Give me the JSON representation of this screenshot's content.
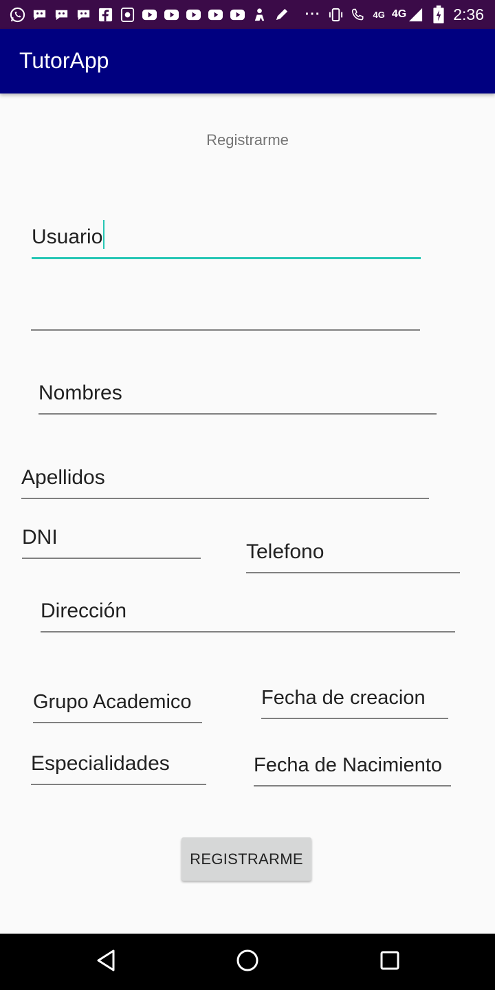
{
  "status_bar": {
    "icons": [
      "whatsapp-icon",
      "messenger-icon",
      "messenger-icon",
      "messenger-icon",
      "facebook-icon",
      "phone-app-icon",
      "youtube-icon",
      "youtube-icon",
      "youtube-icon",
      "youtube-icon",
      "youtube-icon",
      "person-icon",
      "pen-icon"
    ],
    "overflow": "···",
    "network": "4G",
    "network2": "4G",
    "time": "2:36"
  },
  "app_bar": {
    "title": "TutorApp"
  },
  "form": {
    "heading": "Registrarme",
    "fields": {
      "usuario": "Usuario",
      "password": "",
      "nombres": "Nombres",
      "apellidos": "Apellidos",
      "dni": "DNI",
      "telefono": "Telefono",
      "direccion": "Dirección",
      "grupo_academico": "Grupo Academico",
      "fecha_creacion": "Fecha de creacion",
      "especialidades": "Especialidades",
      "fecha_nacimiento": "Fecha de Nacimiento"
    },
    "submit_label": "REGISTRARME"
  },
  "colors": {
    "status_bar": "#3b0b48",
    "app_bar": "#000080",
    "accent": "#26c6b4",
    "button": "#d6d7d7"
  },
  "nav_bar": {
    "icons": [
      "back-icon",
      "home-icon",
      "recents-icon"
    ]
  }
}
